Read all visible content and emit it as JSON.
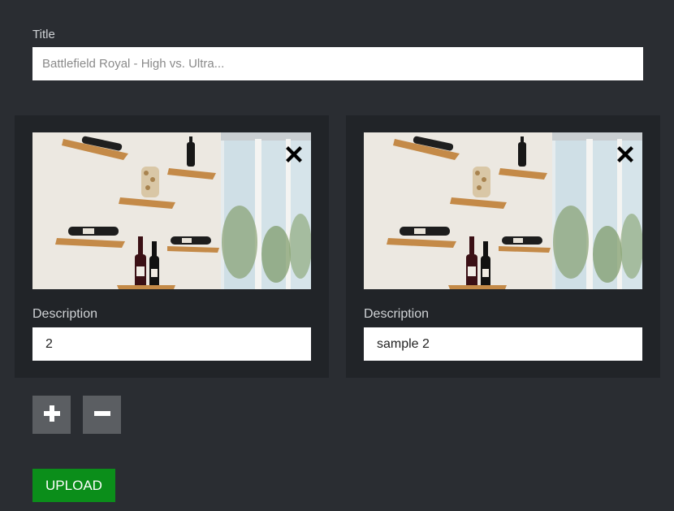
{
  "form": {
    "title_label": "Title",
    "title_placeholder": "Battlefield Royal - High vs. Ultra...",
    "title_value": ""
  },
  "items": [
    {
      "description_label": "Description",
      "description_value": "2",
      "remove_icon": "close-icon"
    },
    {
      "description_label": "Description",
      "description_value": "sample 2",
      "remove_icon": "close-icon"
    }
  ],
  "controls": {
    "add_icon": "plus-icon",
    "remove_icon": "minus-icon",
    "upload_label": "UPLOAD"
  },
  "colors": {
    "background": "#2a2d32",
    "card": "#212428",
    "upload_button": "#0b8e1a",
    "icon_button": "#5b5e62"
  }
}
